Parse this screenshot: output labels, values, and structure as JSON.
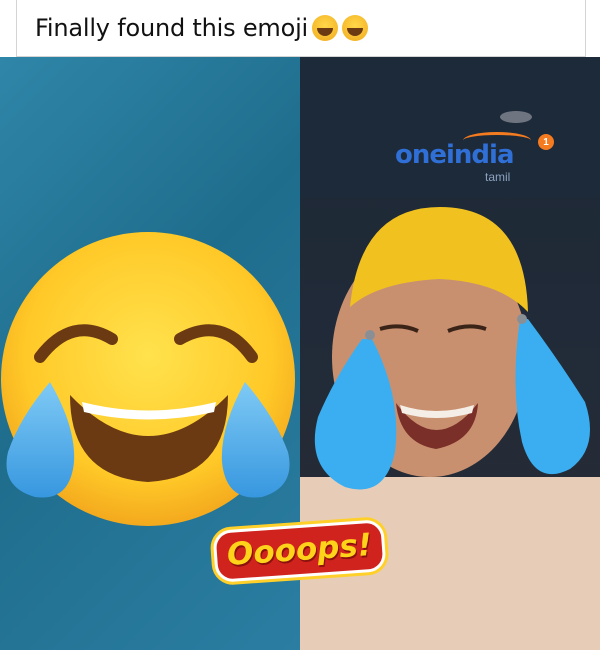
{
  "post": {
    "caption": "Finally found this emoji"
  },
  "icons": {
    "caption_emoji": "face-with-tears-of-joy-icon"
  },
  "watermark": {
    "brand": "oneindia",
    "sub": "tamil",
    "badge": "1"
  },
  "overlay": {
    "text": "Oooops!"
  },
  "colors": {
    "left_background": "#2b7ea2",
    "emoji_yellow": "#ffc928",
    "tears_blue": "#4fb3ee",
    "sticker_red": "#d0231e",
    "sticker_yellow": "#ffd319",
    "watermark_blue": "#2f6fd6"
  }
}
